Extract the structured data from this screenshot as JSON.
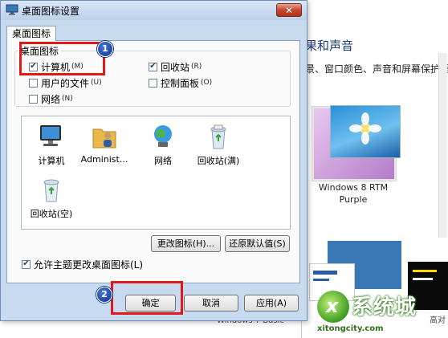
{
  "dialog": {
    "title": "桌面图标设置",
    "close_label": "✕",
    "tab_label": "桌面图标",
    "group_title": "桌面图标",
    "checkboxes": [
      {
        "label": "计算机",
        "key": "(M)",
        "checked": true
      },
      {
        "label": "回收站",
        "key": "(R)",
        "checked": true
      },
      {
        "label": "用户的文件",
        "key": "(U)",
        "checked": false
      },
      {
        "label": "控制面板",
        "key": "(O)",
        "checked": false
      },
      {
        "label": "网络",
        "key": "(N)",
        "checked": false
      }
    ],
    "icons": [
      {
        "icon": "computer-icon",
        "label": "计算机"
      },
      {
        "icon": "user-folder-icon",
        "label": "Administ..."
      },
      {
        "icon": "network-icon",
        "label": "网络"
      },
      {
        "icon": "recycle-bin-full-icon",
        "label": "回收站(满)"
      },
      {
        "icon": "recycle-bin-empty-icon",
        "label": "回收站(空)"
      }
    ],
    "change_icon_button": "更改图标(H)...",
    "restore_default_button": "还原默认值(S)",
    "allow_themes_checkbox": {
      "label": "允许主题更改桌面图标(L)",
      "checked": true
    },
    "ok_button": "确定",
    "cancel_button": "取消",
    "apply_button": "应用(A)"
  },
  "annotations": {
    "step1": "1",
    "step2": "2",
    "highlight_color": "#e01818"
  },
  "background_window": {
    "heading": "更改计算机上的视觉效果和声音",
    "heading_visible": "果和声音",
    "description": "景、窗口颜色、声音和屏幕保护程",
    "theme_name": "Windows 8 RTM Purple",
    "cut_label_left": "Windows 7 Basic",
    "cut_label_right": "高对"
  },
  "watermark": {
    "brand": "系统城",
    "url": "xitongcity.com"
  }
}
